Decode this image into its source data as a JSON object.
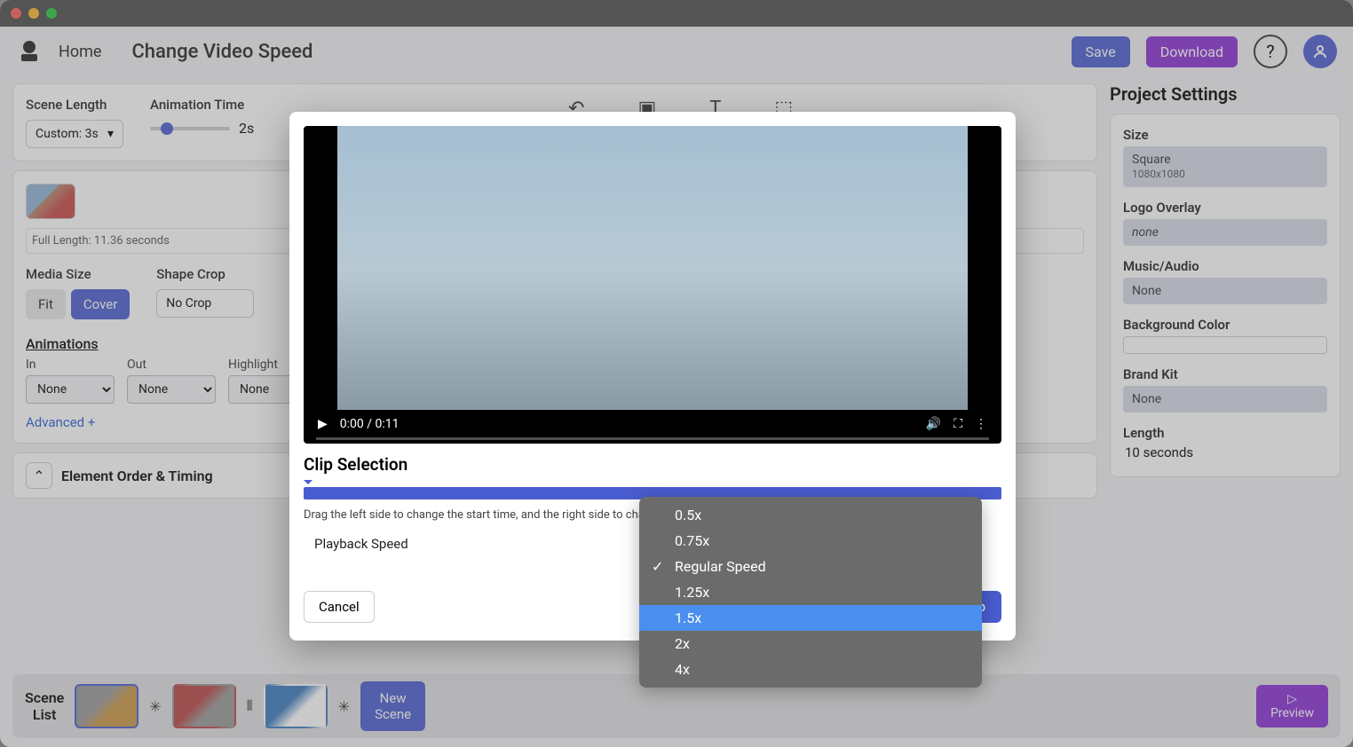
{
  "header": {
    "home": "Home",
    "title": "Change Video Speed",
    "save": "Save",
    "download": "Download"
  },
  "scene_panel": {
    "scene_length_label": "Scene Length",
    "scene_length_value": "Custom: 3s",
    "animation_time_label": "Animation Time",
    "animation_time_value": "2s"
  },
  "media": {
    "full_length": "Full Length: 11.36 seconds",
    "media_size_label": "Media Size",
    "fit": "Fit",
    "cover": "Cover",
    "shape_crop_label": "Shape Crop",
    "shape_crop_value": "No Crop"
  },
  "animations": {
    "title": "Animations",
    "in": "In",
    "out": "Out",
    "highlight": "Highlight",
    "none": "None",
    "advanced": "Advanced +"
  },
  "element_order": "Element Order & Timing",
  "project_settings": {
    "title": "Project Settings",
    "size_label": "Size",
    "size_value": "Square",
    "size_sub": "1080x1080",
    "logo_label": "Logo Overlay",
    "logo_value": "none",
    "music_label": "Music/Audio",
    "music_value": "None",
    "bg_label": "Background Color",
    "brand_label": "Brand Kit",
    "brand_value": "None",
    "length_label": "Length",
    "length_value": "10 seconds"
  },
  "rail": {
    "scene_list": "Scene\nList",
    "new_scene": "New\nScene",
    "preview": "Preview"
  },
  "modal": {
    "time": "0:00 / 0:11",
    "clip_title": "Clip Selection",
    "help": "Drag the left side to change the start time, and the right side to change the end time.",
    "playback_label": "Playback Speed",
    "cancel": "Cancel",
    "crop": "Crop"
  },
  "speed_options": {
    "o0": "0.5x",
    "o1": "0.75x",
    "o2": "Regular Speed",
    "o3": "1.25x",
    "o4": "1.5x",
    "o5": "2x",
    "o6": "4x"
  }
}
